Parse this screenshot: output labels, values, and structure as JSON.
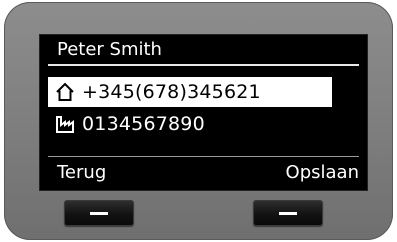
{
  "screen": {
    "title": "Peter Smith",
    "entries": [
      {
        "icon": "home-phone-icon",
        "number": "+345(678)345621",
        "selected": true
      },
      {
        "icon": "office-phone-icon",
        "number": "0134567890",
        "selected": false
      }
    ],
    "softkeys": {
      "left_label": "Terug",
      "right_label": "Opslaan"
    }
  },
  "colors": {
    "screen_bg": "#000000",
    "screen_text": "#ffffff",
    "selection_bg": "#ffffff",
    "device_body": "#7c7c7c"
  }
}
